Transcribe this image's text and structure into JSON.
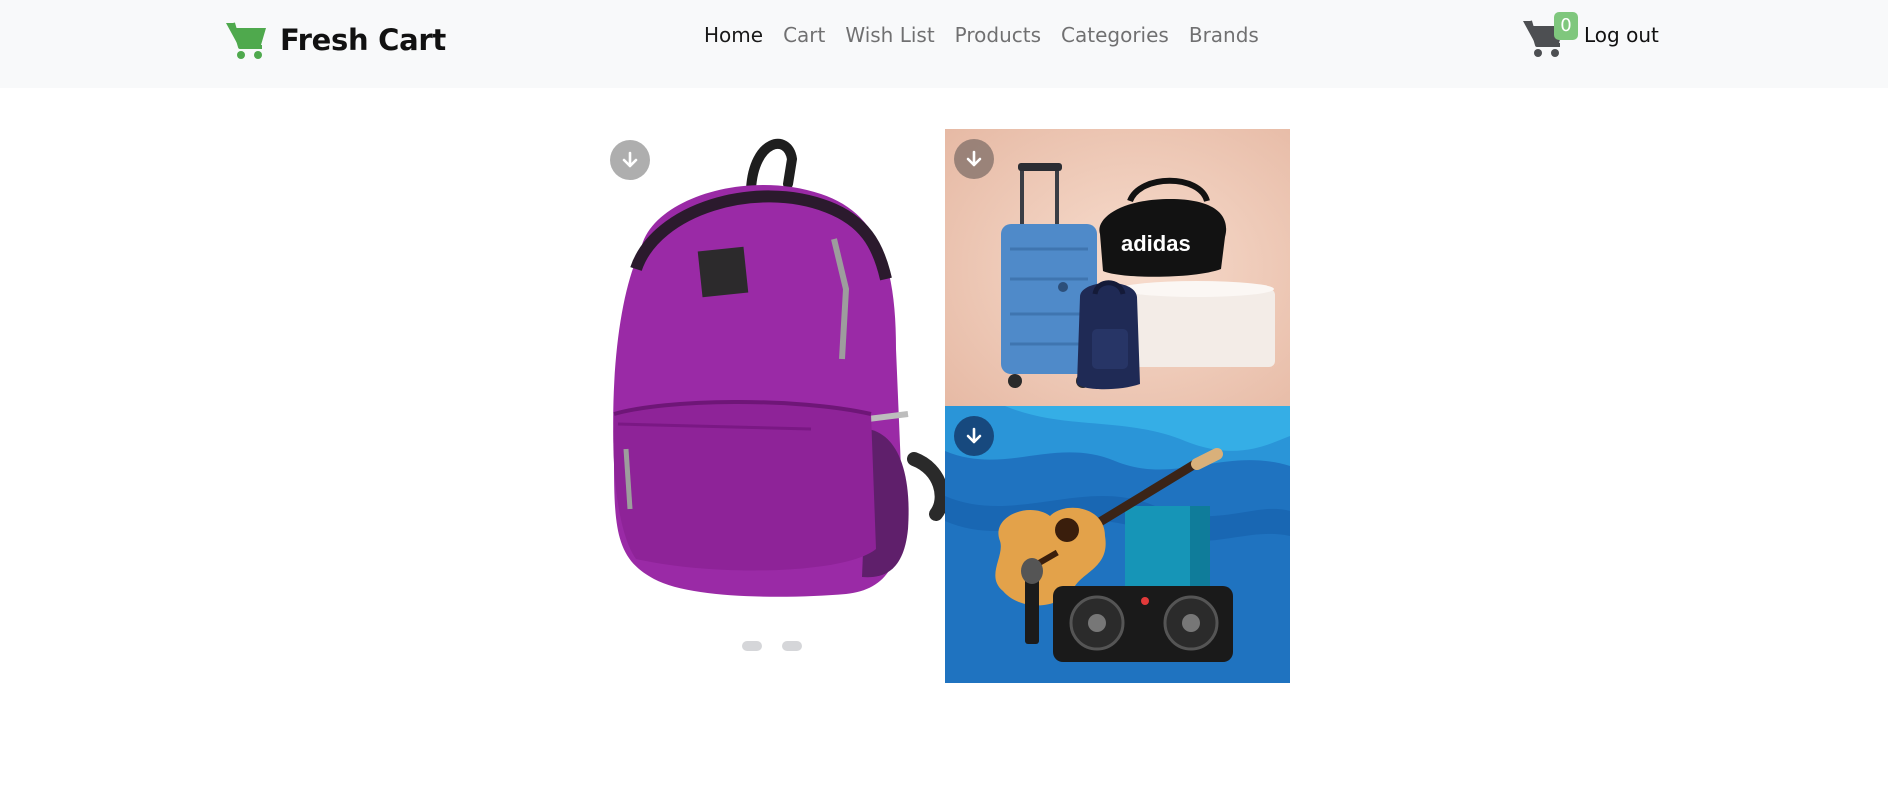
{
  "brand": {
    "name": "Fresh Cart",
    "icon": "cart-icon",
    "icon_color": "#4fa94d"
  },
  "nav": {
    "links": [
      {
        "label": "Home",
        "active": true
      },
      {
        "label": "Cart",
        "active": false
      },
      {
        "label": "Wish List",
        "active": false
      },
      {
        "label": "Products",
        "active": false
      },
      {
        "label": "Categories",
        "active": false
      },
      {
        "label": "Brands",
        "active": false
      }
    ]
  },
  "cart": {
    "icon": "shopping-cart-icon",
    "count": "0",
    "badge_color": "#7fc77d"
  },
  "auth": {
    "logout_label": "Log out"
  },
  "slider": {
    "slides": 2,
    "current_image": "purple backpack",
    "download_icon": "arrow-down-circle-icon"
  },
  "banners": {
    "top": {
      "image": "luggage and bags",
      "brand_text": "adidas"
    },
    "bottom": {
      "image": "guitar and music instruments"
    }
  },
  "colors": {
    "navbar_bg": "#f8f9fa",
    "accent": "#4fa94d",
    "dot": "#d5d6d9"
  }
}
